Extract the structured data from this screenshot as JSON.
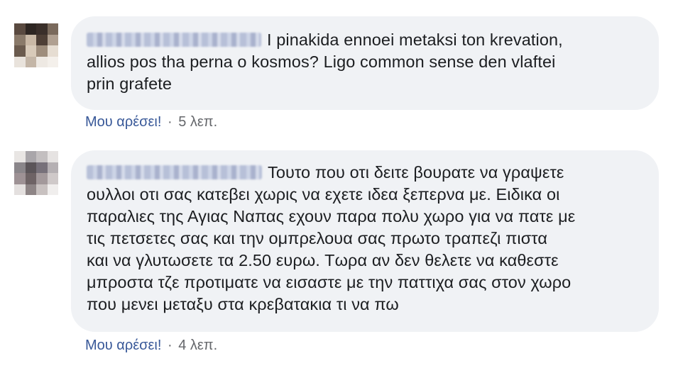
{
  "comments": [
    {
      "author": "",
      "text": "I pinakida ennoei metaksi ton krevation,\nallios pos tha perna o kosmos? Ligo common sense den vlaftei\nprin grafete",
      "like_label": "Μου αρέσει!",
      "separator": "·",
      "time": "5 λεπ."
    },
    {
      "author": "",
      "text": "Τουτο που οτι δειτε βουρατε να γραψετε\nουλλοι οτι σας κατεβει χωρις να εχετε ιδεα ξεπερνα με. Ειδικα οι\nπαραλιες της Αγιας Ναπας εχουν παρα πολυ χωρο για να πατε με\nτις πετσετες σας και την ομπρελουα σας πρωτο τραπεζι πιστα\nκαι να γλυτωσετε τα 2.50 ευρω. Τωρα αν δεν θελετε να καθεστε\nμπροστα τζε προτιματε να εισαστε με την παττιχα σας στον χωρο\nπου μενει μεταξυ στα κρεβατακια τι να πω",
      "like_label": "Μου αρέσει!",
      "separator": "·",
      "time": "4 λεπ."
    }
  ]
}
